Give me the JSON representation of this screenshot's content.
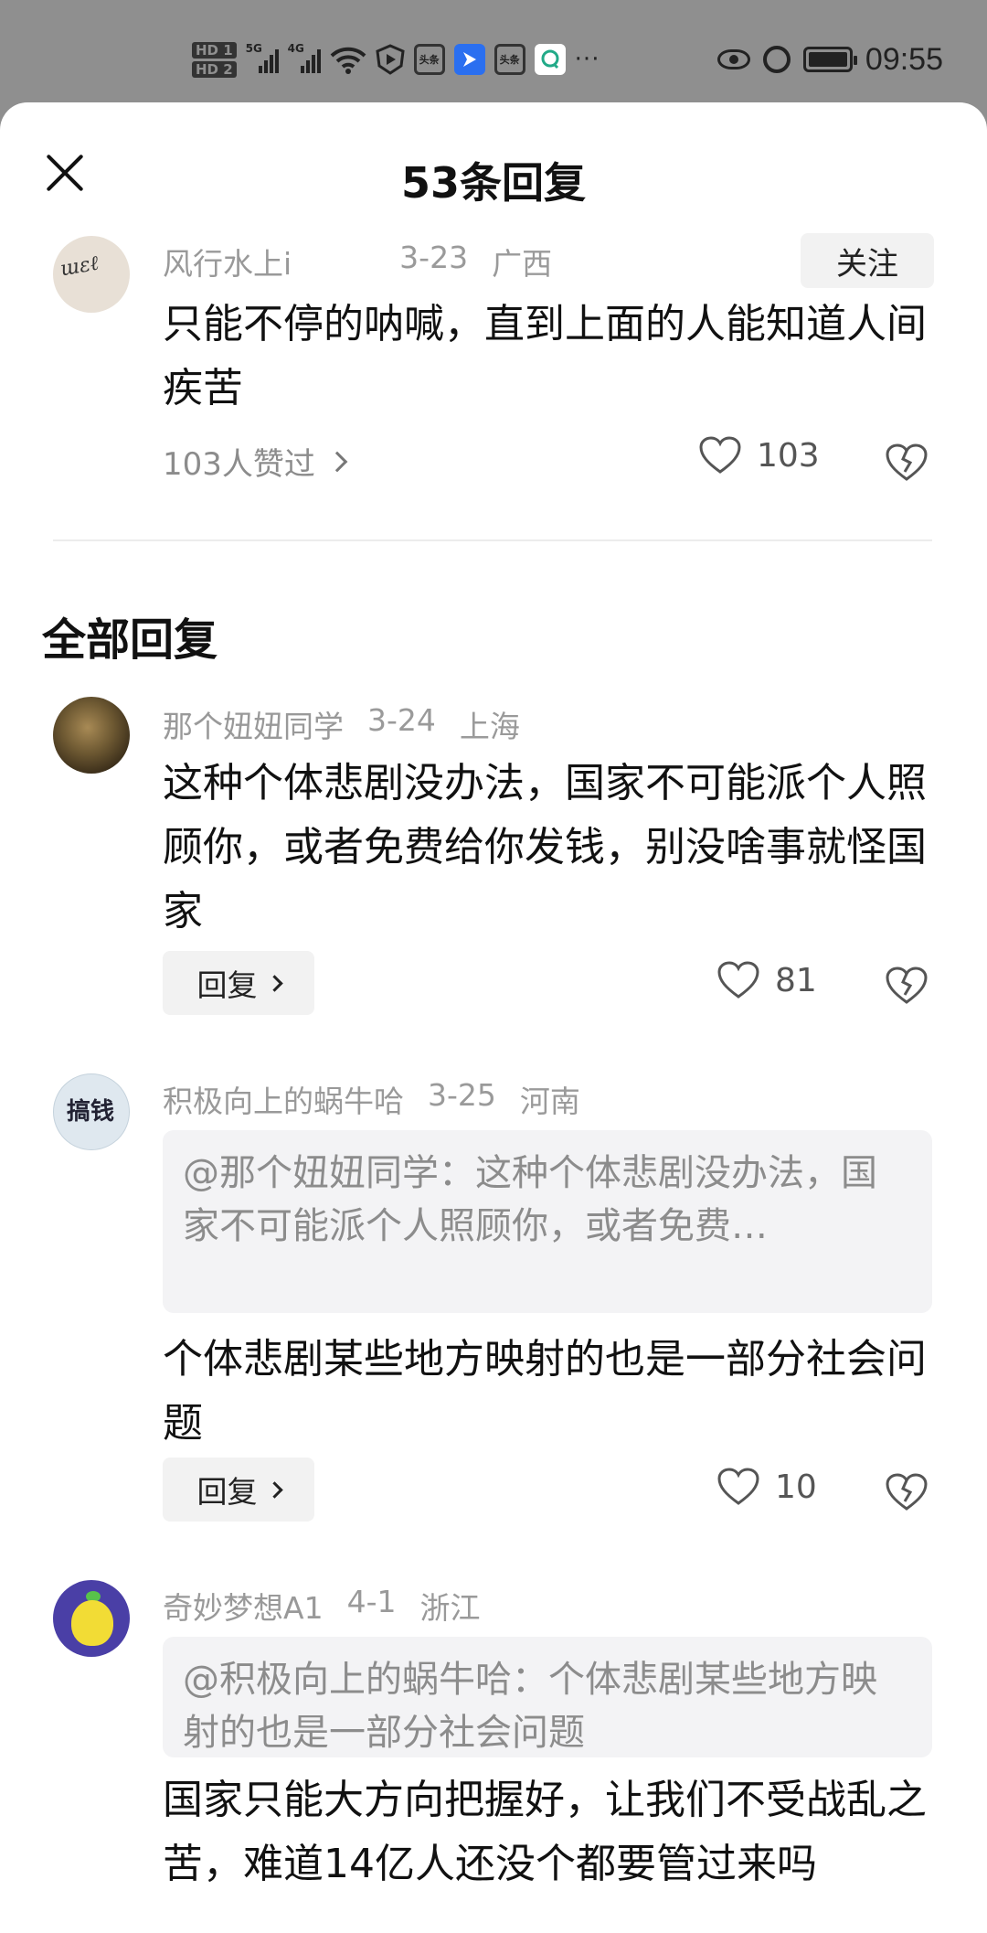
{
  "status_bar": {
    "hd1": "HD 1",
    "hd2": "HD 2",
    "sig1_label": "5G",
    "sig2_label": "4G",
    "app1": "头条",
    "app2": "头条",
    "time": "09:55"
  },
  "sheet": {
    "title": "53条回复"
  },
  "top_comment": {
    "author": "风行水上i",
    "date": "3-23",
    "location": "广西",
    "follow_label": "关注",
    "text": "只能不停的呐喊，直到上面的人能知道人间疾苦",
    "likers_label": "103人赞过",
    "like_count": "103"
  },
  "section_title": "全部回复",
  "replies": [
    {
      "author": "那个妞妞同学",
      "date": "3-24",
      "location": "上海",
      "text": "这种个体悲剧没办法，国家不可能派个人照顾你，或者免费给你发钱，别没啥事就怪国家",
      "reply_label": "回复",
      "like_count": "81"
    },
    {
      "author": "积极向上的蜗牛哈",
      "date": "3-25",
      "location": "河南",
      "quote": "@那个妞妞同学：这种个体悲剧没办法，国家不可能派个人照顾你，或者免费…",
      "text": "个体悲剧某些地方映射的也是一部分社会问题",
      "reply_label": "回复",
      "like_count": "10",
      "avatar_text": "搞钱"
    },
    {
      "author": "奇妙梦想A1",
      "date": "4-1",
      "location": "浙江",
      "quote": "@积极向上的蜗牛哈：个体悲剧某些地方映射的也是一部分社会问题",
      "text": "国家只能大方向把握好，让我们不受战乱之苦，难道14亿人还没个都要管过来吗"
    }
  ]
}
